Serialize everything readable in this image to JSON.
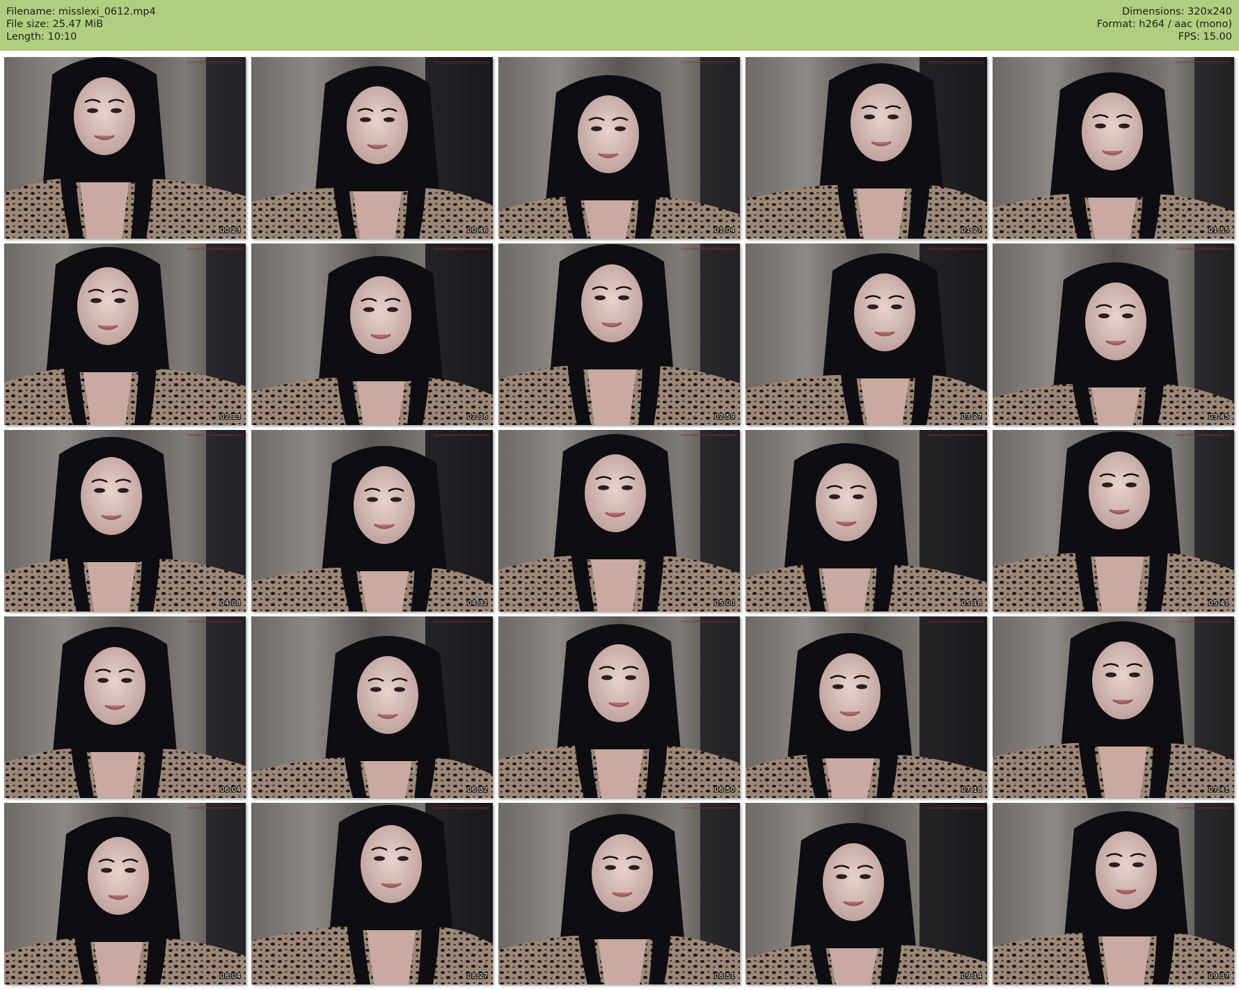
{
  "header": {
    "filename_line": "Filename: misslexi_0612.mp4",
    "filesize_line": "File size: 25.47 MiB",
    "length_line": "Length: 10:10",
    "dimensions_line": "Dimensions: 320x240",
    "format_line": "Format: h264 / aac (mono)",
    "fps_line": "FPS: 15.00",
    "background_color": "#afce7f"
  },
  "thumbnails": [
    {
      "timestamp": "00:23"
    },
    {
      "timestamp": "00:46"
    },
    {
      "timestamp": "01:04"
    },
    {
      "timestamp": "01:27"
    },
    {
      "timestamp": "01:55"
    },
    {
      "timestamp": "02:13"
    },
    {
      "timestamp": "02:36"
    },
    {
      "timestamp": "02:59"
    },
    {
      "timestamp": "03:27"
    },
    {
      "timestamp": "03:45"
    },
    {
      "timestamp": "04:08"
    },
    {
      "timestamp": "04:32"
    },
    {
      "timestamp": "05:00"
    },
    {
      "timestamp": "05:18"
    },
    {
      "timestamp": "05:41"
    },
    {
      "timestamp": "06:04"
    },
    {
      "timestamp": "06:32"
    },
    {
      "timestamp": "06:50"
    },
    {
      "timestamp": "07:18"
    },
    {
      "timestamp": "07:41"
    },
    {
      "timestamp": "08:04"
    },
    {
      "timestamp": "08:27"
    },
    {
      "timestamp": "08:51"
    },
    {
      "timestamp": "09:14"
    },
    {
      "timestamp": "09:37"
    }
  ]
}
